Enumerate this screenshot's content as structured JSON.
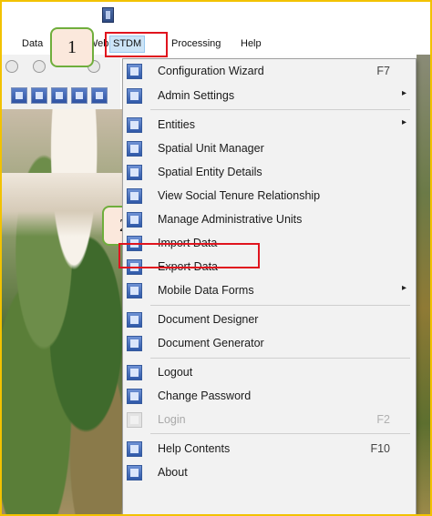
{
  "menubar": {
    "items": [
      "Data",
      "Web",
      "STDM",
      "Processing",
      "Help"
    ]
  },
  "callouts": {
    "first": "1",
    "second": "2"
  },
  "stdm_menu": {
    "items": [
      {
        "label": "Configuration Wizard",
        "shortcut": "F7",
        "submenu": false,
        "enabled": true,
        "icon": "wizard-icon"
      },
      {
        "label": "Admin Settings",
        "shortcut": "",
        "submenu": true,
        "enabled": true,
        "icon": "admin-settings-icon"
      },
      {
        "label": "Entities",
        "shortcut": "",
        "submenu": true,
        "enabled": true,
        "icon": "entities-icon"
      },
      {
        "label": "Spatial Unit Manager",
        "shortcut": "",
        "submenu": false,
        "enabled": true,
        "icon": "spatial-unit-icon"
      },
      {
        "label": "Spatial Entity Details",
        "shortcut": "",
        "submenu": false,
        "enabled": true,
        "icon": "spatial-entity-icon"
      },
      {
        "label": "View Social Tenure Relationship",
        "shortcut": "",
        "submenu": false,
        "enabled": true,
        "icon": "social-tenure-icon"
      },
      {
        "label": "Manage Administrative Units",
        "shortcut": "",
        "submenu": false,
        "enabled": true,
        "icon": "admin-units-icon"
      },
      {
        "label": "Import Data",
        "shortcut": "",
        "submenu": false,
        "enabled": true,
        "icon": "import-icon"
      },
      {
        "label": "Export Data",
        "shortcut": "",
        "submenu": false,
        "enabled": true,
        "icon": "export-icon"
      },
      {
        "label": "Mobile Data Forms",
        "shortcut": "",
        "submenu": true,
        "enabled": true,
        "icon": "mobile-forms-icon"
      },
      {
        "label": "Document Designer",
        "shortcut": "",
        "submenu": false,
        "enabled": true,
        "icon": "document-designer-icon"
      },
      {
        "label": "Document Generator",
        "shortcut": "",
        "submenu": false,
        "enabled": true,
        "icon": "document-generator-icon"
      },
      {
        "label": "Logout",
        "shortcut": "",
        "submenu": false,
        "enabled": true,
        "icon": "logout-icon"
      },
      {
        "label": "Change Password",
        "shortcut": "",
        "submenu": false,
        "enabled": true,
        "icon": "password-icon"
      },
      {
        "label": "Login",
        "shortcut": "F2",
        "submenu": false,
        "enabled": false,
        "icon": "login-icon"
      },
      {
        "label": "Help Contents",
        "shortcut": "F10",
        "submenu": false,
        "enabled": true,
        "icon": "help-icon"
      },
      {
        "label": "About",
        "shortcut": "",
        "submenu": false,
        "enabled": true,
        "icon": "about-icon"
      }
    ]
  },
  "colors": {
    "highlight_border": "#e0141e",
    "callout_border": "#6fae3c",
    "callout_fill": "#fbe8dc",
    "frame_border": "#f2c200"
  }
}
